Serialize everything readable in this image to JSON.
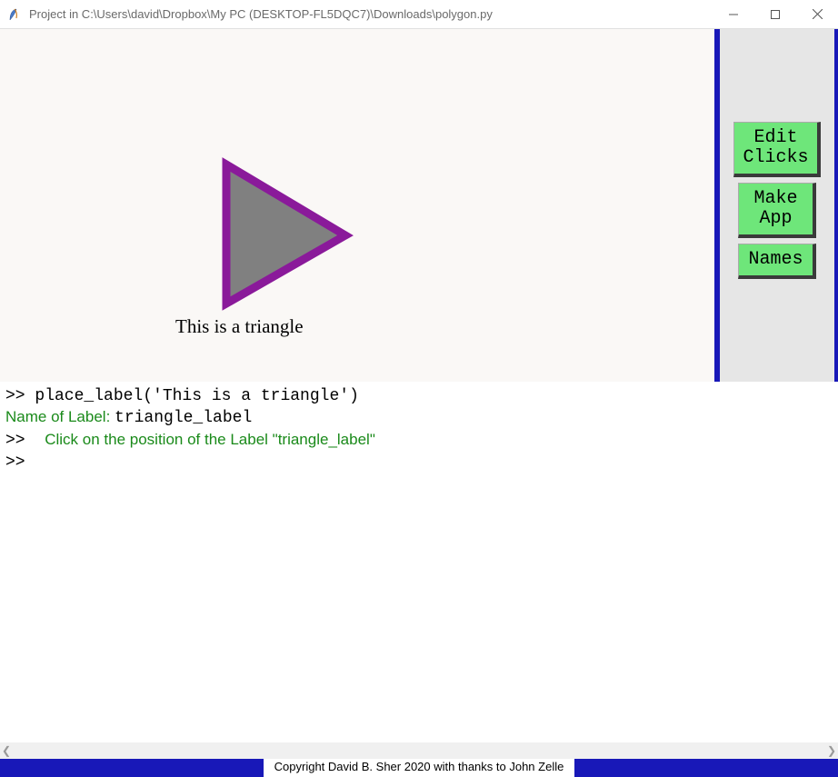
{
  "titlebar": {
    "title": "Project in C:\\Users\\david\\Dropbox\\My PC (DESKTOP-FL5DQC7)\\Downloads\\polygon.py"
  },
  "canvas": {
    "triangle_label": "This is a triangle"
  },
  "sidebar": {
    "buttons": {
      "edit_clicks": "Edit\nClicks",
      "make_app": "Make\nApp",
      "names": "Names"
    }
  },
  "console": {
    "line1_prompt": ">> ",
    "line1_cmd": "place_label('This is a triangle')",
    "line2_label": "Name of Label: ",
    "line2_value": "triangle_label",
    "line3_prompt": ">>  ",
    "line3_msg": "Click on the position of the Label \"triangle_label\"",
    "line4_prompt": ">>"
  },
  "footer": {
    "text": "Copyright David B. Sher 2020 with thanks to John Zelle"
  }
}
